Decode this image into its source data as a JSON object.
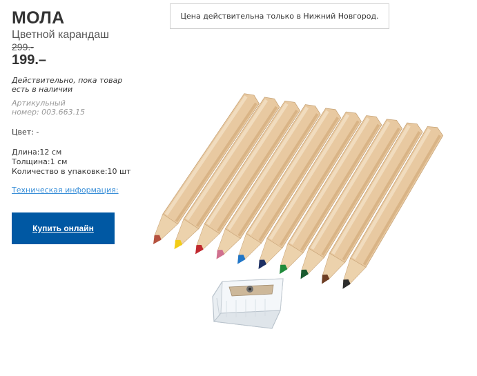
{
  "notice": "Цена действительна только в Нижний Новгород.",
  "product": {
    "name": "МОЛА",
    "type": "Цветной карандаш",
    "old_price": "299.-",
    "price": "199.–",
    "availability": "Действительно, пока товар есть в наличии",
    "article_label": "Артикульный",
    "article_number": "номер: 003.663.15",
    "color": "Цвет: -",
    "specs": {
      "length": "Длина:12 см",
      "thickness": "Толщина:1 см",
      "quantity": "Количество в упаковке:10 шт"
    },
    "tech_link": "Техническая информация:",
    "buy_button": "Купить онлайн"
  },
  "colors": {
    "button": "#0058a3",
    "link": "#3a8fd8"
  },
  "image": {
    "pencil_tip_colors": [
      "#b5513e",
      "#f2cc16",
      "#c0282e",
      "#d0708f",
      "#2176c7",
      "#1d2f63",
      "#1f8a3a",
      "#1a5a2f",
      "#6e3e24",
      "#2d2d2d"
    ]
  }
}
